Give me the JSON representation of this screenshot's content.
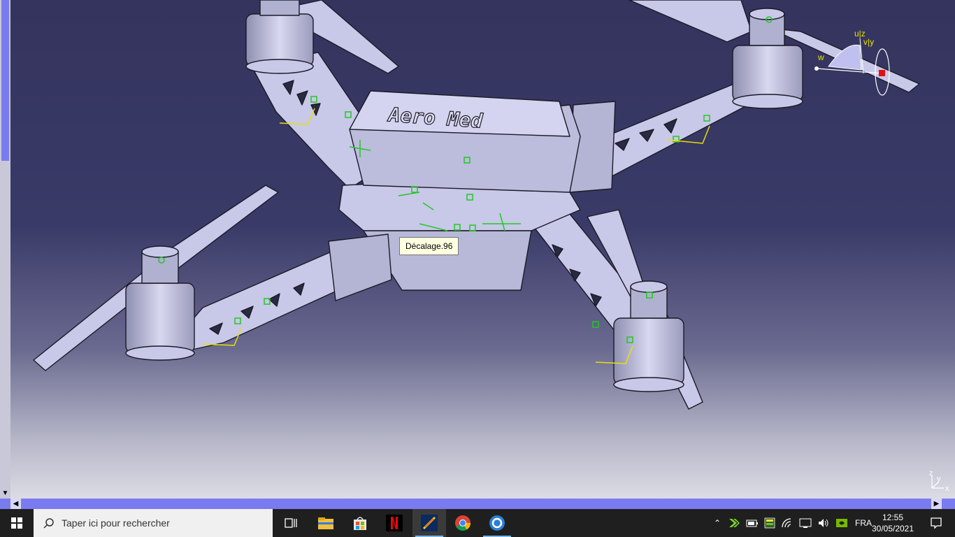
{
  "viewport": {
    "tooltip": "Décalage.96",
    "model_text": "Aero Med",
    "compass_labels": {
      "uz": "u|z",
      "vy": "v|y",
      "w": "w"
    },
    "axis_labels": {
      "z": "z",
      "y": "y",
      "x": "x"
    }
  },
  "taskbar": {
    "search_placeholder": "Taper ici pour rechercher",
    "apps": [
      "task-view",
      "file-explorer",
      "microsoft-store",
      "netflix",
      "catia",
      "chrome",
      "app"
    ],
    "tray_language": "FRA",
    "clock_time": "12:55",
    "clock_date": "30/05/2021"
  },
  "colors": {
    "background_top": "#34345e",
    "background_bottom": "#dcdce4",
    "part_fill": "#c8c8e8",
    "edge": "#1a1a28",
    "constraint_green": "#22c822",
    "axis_yellow": "#e8e000",
    "scrollbar": "#7b7bf0",
    "taskbar": "#1f1f1f"
  }
}
